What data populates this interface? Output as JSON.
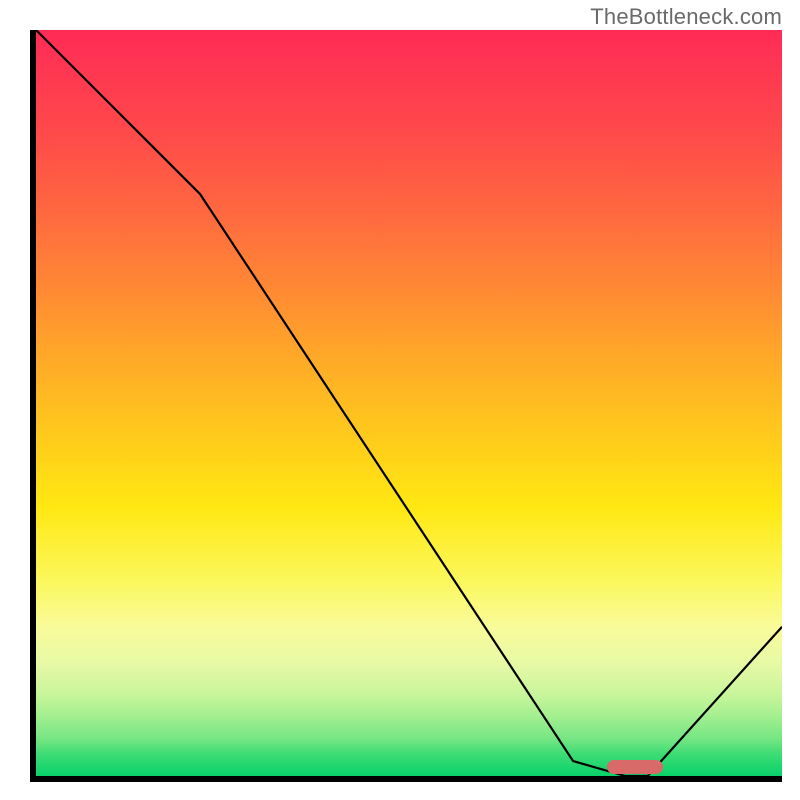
{
  "watermark": {
    "text": "TheBottleneck.com"
  },
  "colors": {
    "gradient_top": "#ff2b56",
    "gradient_mid": "#ffe812",
    "gradient_bottom": "#08d26a",
    "curve": "#000000",
    "axis": "#000000",
    "marker": "#d86a6a"
  },
  "chart_data": {
    "type": "line",
    "title": "",
    "xlabel": "",
    "ylabel": "",
    "xlim": [
      0,
      100
    ],
    "ylim": [
      0,
      100
    ],
    "grid": false,
    "legend": false,
    "x": [
      0,
      22,
      72,
      79,
      82,
      100
    ],
    "y": [
      100,
      78,
      2,
      0,
      0,
      20
    ],
    "optimal_range_x": [
      76.5,
      84
    ],
    "optimal_range_y": 1.2,
    "marker_thickness_pct": 2.0
  }
}
